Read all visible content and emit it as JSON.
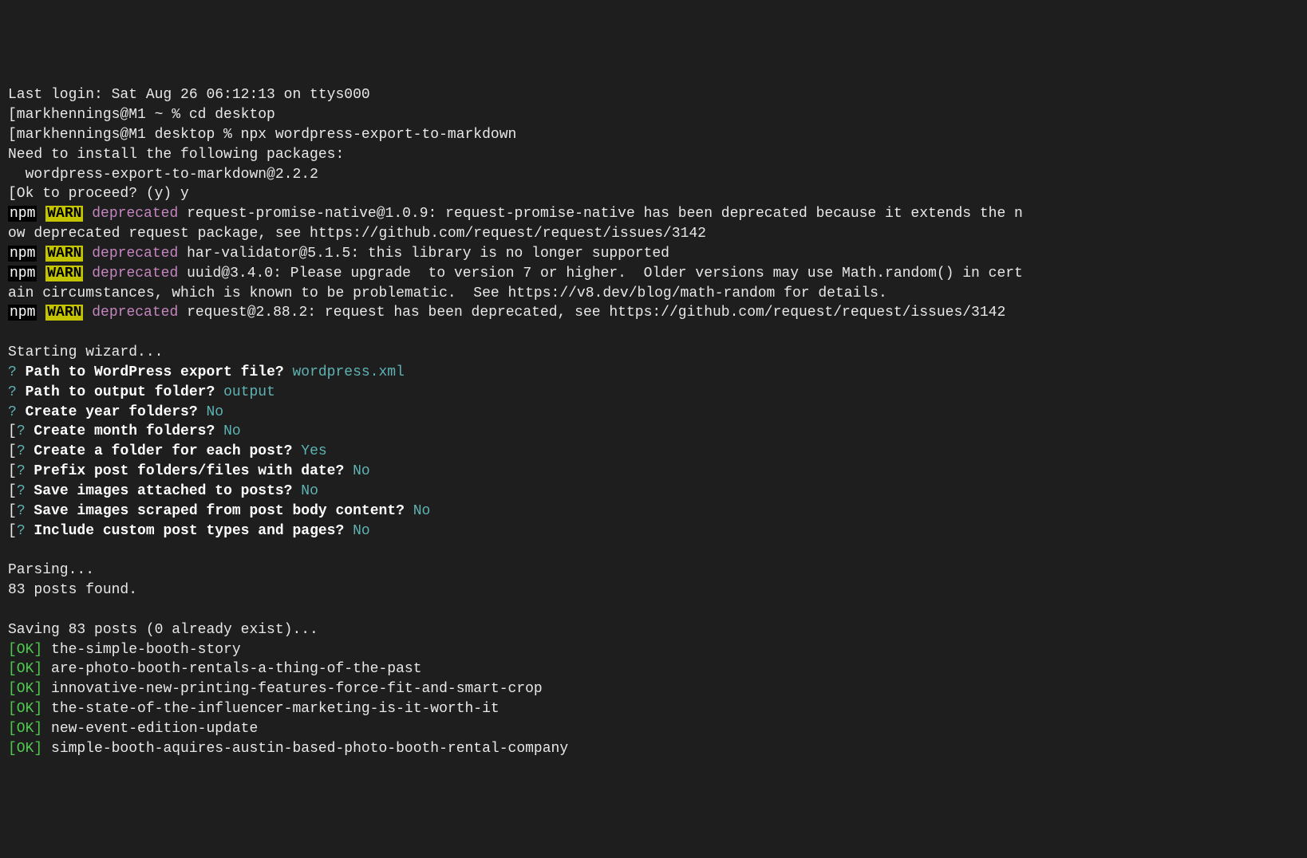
{
  "login": "Last login: Sat Aug 26 06:12:13 on ttys000",
  "prompts": {
    "p1": "[markhennings@M1 ~ % cd desktop",
    "p2": "[markhennings@M1 desktop % npx wordpress-export-to-markdown"
  },
  "install": {
    "need": "Need to install the following packages:",
    "pkg": "  wordpress-export-to-markdown@2.2.2",
    "proceed": "[Ok to proceed? (y) y"
  },
  "npm_label": "npm",
  "warn_label": "WARN",
  "deprecated_label": "deprecated",
  "warnings": {
    "w1": " request-promise-native@1.0.9: request-promise-native has been deprecated because it extends the n",
    "w1b": "ow deprecated request package, see https://github.com/request/request/issues/3142",
    "w2": " har-validator@5.1.5: this library is no longer supported",
    "w3": " uuid@3.4.0: Please upgrade  to version 7 or higher.  Older versions may use Math.random() in cert",
    "w3b": "ain circumstances, which is known to be problematic.  See https://v8.dev/blog/math-random for details.",
    "w4": " request@2.88.2: request has been deprecated, see https://github.com/request/request/issues/3142"
  },
  "wizard": {
    "starting": "Starting wizard...",
    "q_mark": "?",
    "lbracket_q": "[?",
    "q1": " Path to WordPress export file? ",
    "a1": "wordpress.xml",
    "q2": " Path to output folder? ",
    "a2": "output",
    "q3": " Create year folders? ",
    "a3": "No",
    "q4": " Create month folders? ",
    "a4": "No",
    "q5": " Create a folder for each post? ",
    "a5": "Yes",
    "q6": " Prefix post folders/files with date? ",
    "a6": "No",
    "q7": " Save images attached to posts? ",
    "a7": "No",
    "q8": " Save images scraped from post body content? ",
    "a8": "No",
    "q9": " Include custom post types and pages? ",
    "a9": "No"
  },
  "parsing": {
    "label": "Parsing...",
    "found": "83 posts found."
  },
  "saving": "Saving 83 posts (0 already exist)...",
  "ok_label": "[OK]",
  "posts": {
    "p1": " the-simple-booth-story",
    "p2": " are-photo-booth-rentals-a-thing-of-the-past",
    "p3": " innovative-new-printing-features-force-fit-and-smart-crop",
    "p4": " the-state-of-the-influencer-marketing-is-it-worth-it",
    "p5": " new-event-edition-update",
    "p6": " simple-booth-aquires-austin-based-photo-booth-rental-company"
  }
}
